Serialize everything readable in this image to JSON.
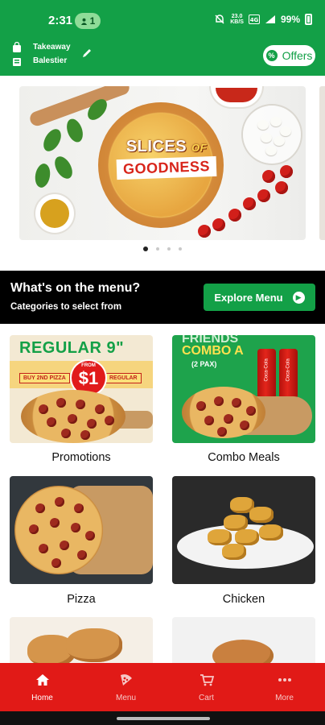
{
  "status_bar": {
    "time": "2:31",
    "notification_count": "1",
    "speed_value": "23.0",
    "speed_unit": "KB/S",
    "battery": "99%"
  },
  "header": {
    "order_mode": "Takeaway",
    "location": "Balestier",
    "offers_label": "Offers",
    "offers_badge": "%"
  },
  "banner": {
    "headline_1": "SLICES",
    "headline_of": "OF",
    "headline_2": "GOODNESS",
    "slide_count": 4,
    "active_slide": 1
  },
  "menu_section": {
    "title": "What's on the menu?",
    "subtitle": "Categories to select from",
    "explore_label": "Explore Menu"
  },
  "categories": [
    {
      "label": "Promotions",
      "headline": "REGULAR 9\"",
      "price": "$1",
      "price_from": "FROM",
      "tag_left": "BUY 2ND PIZZA",
      "tag_right": "REGULAR"
    },
    {
      "label": "Combo Meals",
      "headline": "FRIENDS",
      "combo": "COMBO A",
      "pax": "(2 PAX)"
    },
    {
      "label": "Pizza"
    },
    {
      "label": "Chicken"
    },
    {
      "label": ""
    },
    {
      "label": ""
    }
  ],
  "bottom_nav": [
    {
      "label": "Home",
      "icon": "home-icon",
      "active": true
    },
    {
      "label": "Menu",
      "icon": "pizza-slice-icon",
      "active": false
    },
    {
      "label": "Cart",
      "icon": "cart-icon",
      "active": false
    },
    {
      "label": "More",
      "icon": "more-icon",
      "active": false
    }
  ],
  "colors": {
    "brand_green": "#13a047",
    "nav_red": "#e11a17",
    "black_strip": "#000000"
  }
}
